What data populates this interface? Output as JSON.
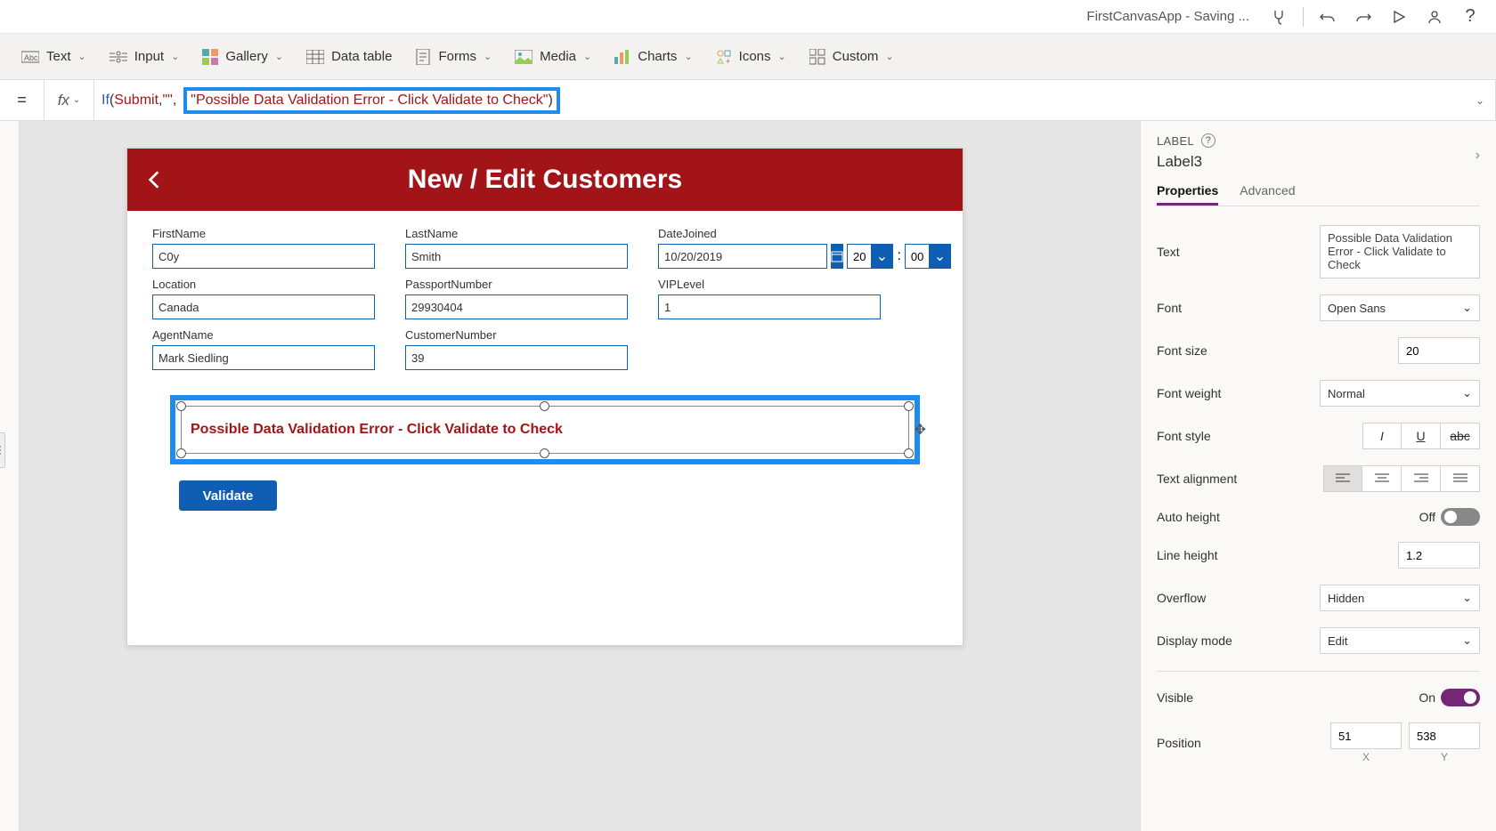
{
  "app_title": "FirstCanvasApp - Saving ...",
  "ribbon": {
    "text": "Text",
    "input": "Input",
    "gallery": "Gallery",
    "data_table": "Data table",
    "forms": "Forms",
    "media": "Media",
    "charts": "Charts",
    "icons": "Icons",
    "custom": "Custom"
  },
  "formula": {
    "if": "If",
    "arg1": "Submit",
    "str1": "\"\"",
    "str2": "\"Possible Data Validation Error - Click Validate to Check\""
  },
  "canvas": {
    "title": "New / Edit Customers",
    "fields": {
      "FirstName": {
        "label": "FirstName",
        "value": "C0y"
      },
      "LastName": {
        "label": "LastName",
        "value": "Smith"
      },
      "DateJoined": {
        "label": "DateJoined",
        "value": "10/20/2019",
        "hour": "20",
        "minute": "00"
      },
      "Location": {
        "label": "Location",
        "value": "Canada"
      },
      "PassportNumber": {
        "label": "PassportNumber",
        "value": "29930404"
      },
      "VIPLevel": {
        "label": "VIPLevel",
        "value": "1"
      },
      "AgentName": {
        "label": "AgentName",
        "value": "Mark Siedling"
      },
      "CustomerNumber": {
        "label": "CustomerNumber",
        "value": "39"
      }
    },
    "validation_msg": "Possible Data Validation Error - Click Validate to Check",
    "validate_btn": "Validate"
  },
  "rpanel": {
    "type": "LABEL",
    "name": "Label3",
    "tabs": {
      "properties": "Properties",
      "advanced": "Advanced"
    },
    "text_label": "Text",
    "text_value": "Possible Data Validation Error - Click Validate to Check",
    "font_label": "Font",
    "font_value": "Open Sans",
    "fontsize_label": "Font size",
    "fontsize_value": "20",
    "fontweight_label": "Font weight",
    "fontweight_value": "Normal",
    "fontstyle_label": "Font style",
    "textalign_label": "Text alignment",
    "autoheight_label": "Auto height",
    "autoheight_state": "Off",
    "lineheight_label": "Line height",
    "lineheight_value": "1.2",
    "overflow_label": "Overflow",
    "overflow_value": "Hidden",
    "displaymode_label": "Display mode",
    "displaymode_value": "Edit",
    "visible_label": "Visible",
    "visible_state": "On",
    "position_label": "Position",
    "position_x": "51",
    "position_y": "538",
    "x_lbl": "X",
    "y_lbl": "Y"
  }
}
